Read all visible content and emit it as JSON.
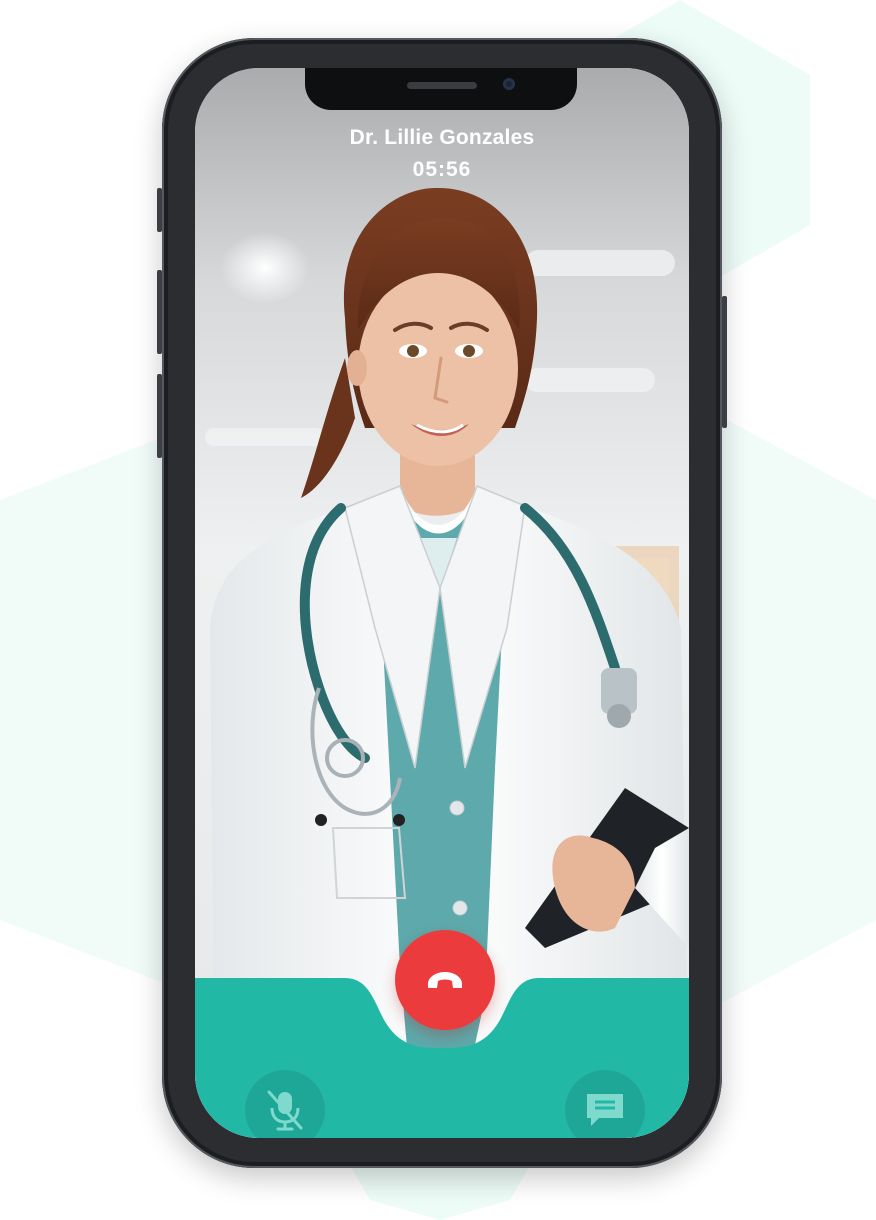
{
  "call": {
    "caller_name": "Dr. Lillie Gonzales",
    "duration": "05:56"
  },
  "controls": {
    "mute_icon": "microphone-off-icon",
    "end_call_icon": "phone-hangup-icon",
    "chat_icon": "chat-bubble-icon"
  },
  "colors": {
    "accent": "#22b8a6",
    "end_call": "#ec3b3d",
    "hexagon": "#eefcf8"
  }
}
